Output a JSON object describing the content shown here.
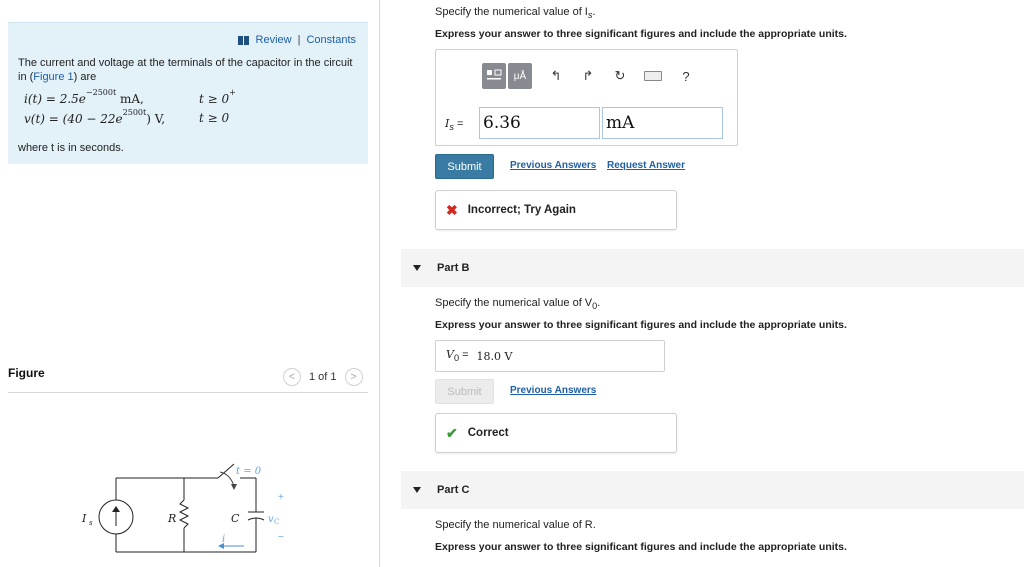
{
  "left": {
    "review_label": "Review",
    "separator": "|",
    "constants_label": "Constants",
    "intro_text": "The current and voltage at the terminals of the capacitor in the circuit in (",
    "figure_link": "Figure 1",
    "intro_suffix": ") are",
    "eq1_lhs": "i(t) = 2.5e",
    "eq1_exp": "−2500t",
    "eq1_unit": " mA,",
    "eq1_cond": "t ≥ 0",
    "eq1_cond_sup": "+",
    "eq2_lhs": "v(t) = (40 − 22e",
    "eq2_exp": "2500t",
    "eq2_unit": ") V,",
    "eq2_cond": "t ≥ 0",
    "where_text": "where t is in seconds.",
    "figure_title": "Figure",
    "pager_text": "1 of 1",
    "circuit": {
      "switch_label": "t = 0",
      "source_label": "I",
      "source_sub": "s",
      "resistor_label": "R",
      "capacitor_label": "C",
      "vc_label": "v",
      "vc_sub": "C",
      "plus": "+",
      "minus": "−",
      "current_label": "i"
    }
  },
  "part_a": {
    "question": "Specify the numerical value of I",
    "question_sub": "s",
    "question_end": ".",
    "instruction": "Express your answer to three significant figures and include the appropriate units.",
    "toolbar": {
      "units_label": "μÅ",
      "help_label": "?"
    },
    "answer_label": "I",
    "answer_label_sub": "s",
    "answer_eq": " =",
    "answer_value": "6.36",
    "answer_unit": "mA",
    "submit_label": "Submit",
    "previous_answers": "Previous Answers",
    "request_answer": "Request Answer",
    "feedback": "Incorrect; Try Again"
  },
  "part_b": {
    "title": "Part B",
    "question": "Specify the numerical value of V",
    "question_sub": "0",
    "question_end": ".",
    "instruction": "Express your answer to three significant figures and include the appropriate units.",
    "answer_label": "V",
    "answer_label_sub": "0",
    "answer_eq": " =",
    "answer_value": "18.0 V",
    "submit_label": "Submit",
    "previous_answers": "Previous Answers",
    "feedback": "Correct"
  },
  "part_c": {
    "title": "Part C",
    "question": "Specify the numerical value of R.",
    "instruction": "Express your answer to three significant figures and include the appropriate units."
  },
  "colors": {
    "info_bg": "#e3f1f8",
    "link": "#1e5fa8",
    "submit_bg": "#3a7ba3",
    "error": "#d0281f",
    "success": "#3a9a36"
  }
}
